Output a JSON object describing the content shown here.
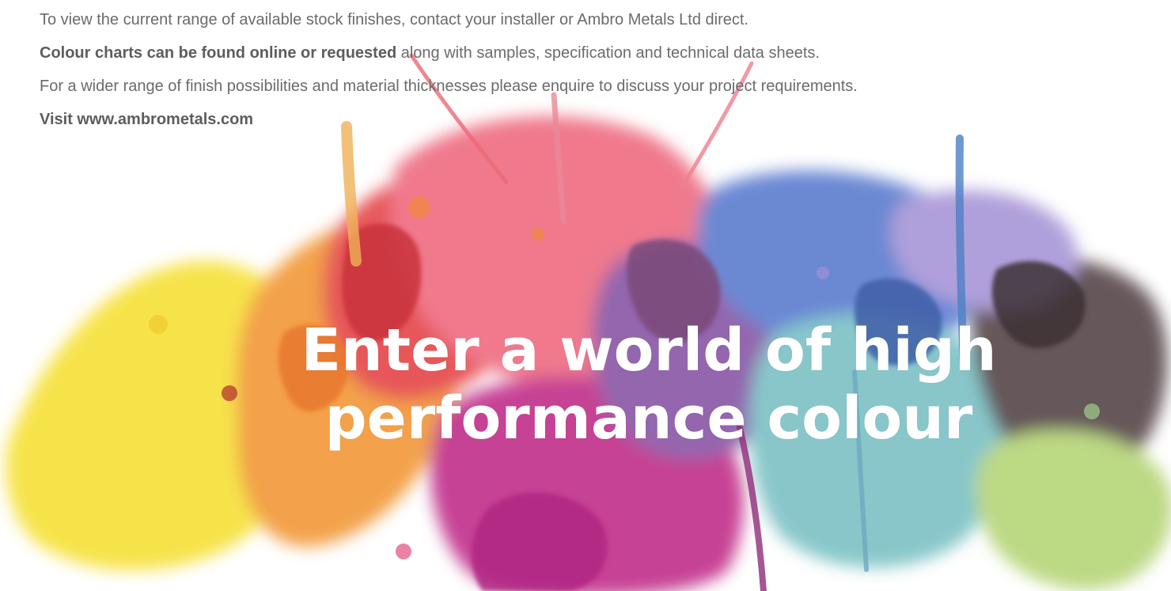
{
  "text": {
    "line1": "To view the current range of available stock finishes, contact your installer or Ambro Metals Ltd direct.",
    "line2_bold": "Colour charts can be found online or requested",
    "line2_rest": " along with samples, specification and technical data sheets.",
    "line3": "For a wider range of finish possibilities and material thicknesses please enquire to discuss your project requirements.",
    "line4": "Visit www.ambrometals.com"
  },
  "headline": {
    "line1": "Enter  a world of high",
    "line2": "performance colour"
  },
  "colors": {
    "text": "#6b6b6b",
    "headline": "#ffffff",
    "yellow": "#f7e23a",
    "orange": "#f39a3b",
    "red": "#e8494a",
    "pink": "#ef6f86",
    "magenta": "#c2318e",
    "purple": "#6e63b6",
    "blue": "#4f8fd0",
    "teal": "#73bcc4",
    "brown": "#5a4a4e",
    "green": "#b5d77a"
  }
}
